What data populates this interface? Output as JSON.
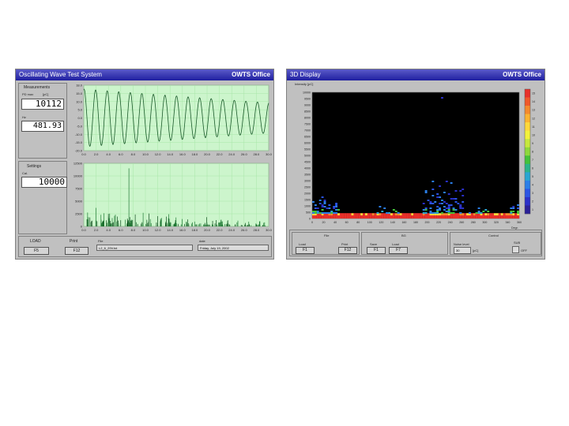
{
  "left_window": {
    "title": "Oscillating Wave Test System",
    "brand": "OWTS Office",
    "measurements": {
      "heading": "Measurements",
      "pd_label": "PD max",
      "pd_unit": "[pC]",
      "pd_value": "10112",
      "hz_label": "Hz",
      "hz_value": "481.93"
    },
    "settings": {
      "heading": "Settings",
      "cal_label": "Cal.",
      "cal_value": "10000"
    },
    "top_chart": {
      "yticks": [
        "18.0",
        "15.0",
        "10.0",
        "5.0",
        "0.0",
        "-5.0",
        "-10.0",
        "-15.0",
        "-20.0"
      ],
      "xticks": [
        "0.0",
        "2.0",
        "4.0",
        "6.0",
        "8.0",
        "10.0",
        "12.0",
        "14.0",
        "16.0",
        "18.0",
        "20.0",
        "22.0",
        "24.0",
        "26.0",
        "28.0",
        "30.0"
      ]
    },
    "bottom_chart": {
      "yticks": [
        "12500",
        "10000",
        "7500",
        "5000",
        "2500",
        "0"
      ],
      "xticks": [
        "0.0",
        "2.0",
        "4.0",
        "6.0",
        "8.0",
        "10.0",
        "12.0",
        "14.0",
        "16.0",
        "18.0",
        "20.0",
        "22.0",
        "24.0",
        "26.0",
        "28.0",
        "30.0"
      ]
    },
    "footer": {
      "load_label": "LOAD",
      "load_key": "F5",
      "print_label": "Print",
      "print_key": "F12",
      "file_label": "File",
      "file_value": "L2_6_29V.txt",
      "date_label": "date",
      "date_value": "Friday, July 19, 2002"
    }
  },
  "right_window": {
    "title": "3D Display",
    "brand": "OWTS Office",
    "intensity_label": "Intensity [pC]",
    "yticks": [
      "10000",
      "9500",
      "9000",
      "8500",
      "8000",
      "7500",
      "7000",
      "6500",
      "6000",
      "5500",
      "5000",
      "4500",
      "4000",
      "3500",
      "3000",
      "2500",
      "2000",
      "1500",
      "1000",
      "500",
      "0"
    ],
    "xticks": [
      "0",
      "20",
      "40",
      "60",
      "80",
      "100",
      "120",
      "140",
      "160",
      "180",
      "200",
      "220",
      "240",
      "260",
      "280",
      "300",
      "320",
      "340",
      "360"
    ],
    "x_unit": "Degr.",
    "colorbar_ticks": [
      "15",
      "14",
      "13",
      "12",
      "11",
      "10",
      "9",
      "8",
      "7",
      "6",
      "5",
      "4",
      "3",
      "2",
      "1"
    ],
    "colorbar_colors": [
      "#e8302a",
      "#f0582a",
      "#f58a2c",
      "#fbb32f",
      "#ffd83a",
      "#f2f23c",
      "#c6e83e",
      "#8ed83c",
      "#44c23a",
      "#2cb48a",
      "#2aa6d2",
      "#2a7ee8",
      "#2a54e4",
      "#2a30c8",
      "#2a2098"
    ],
    "footer": {
      "file_heading": "File",
      "file_load_label": "Load",
      "file_load_key": "F1",
      "file_print_label": "Print",
      "file_print_key": "F12",
      "bg_heading": "BG",
      "bg_save_label": "Save",
      "bg_save_key": "F1",
      "bg_load_label": "Load",
      "bg_load_key": "F7",
      "control_heading": "Control",
      "noise_label": "Noise level",
      "noise_value": "30",
      "noise_unit": "[pC]",
      "sub_label": "SUB",
      "sub_value": "OFF"
    }
  }
}
